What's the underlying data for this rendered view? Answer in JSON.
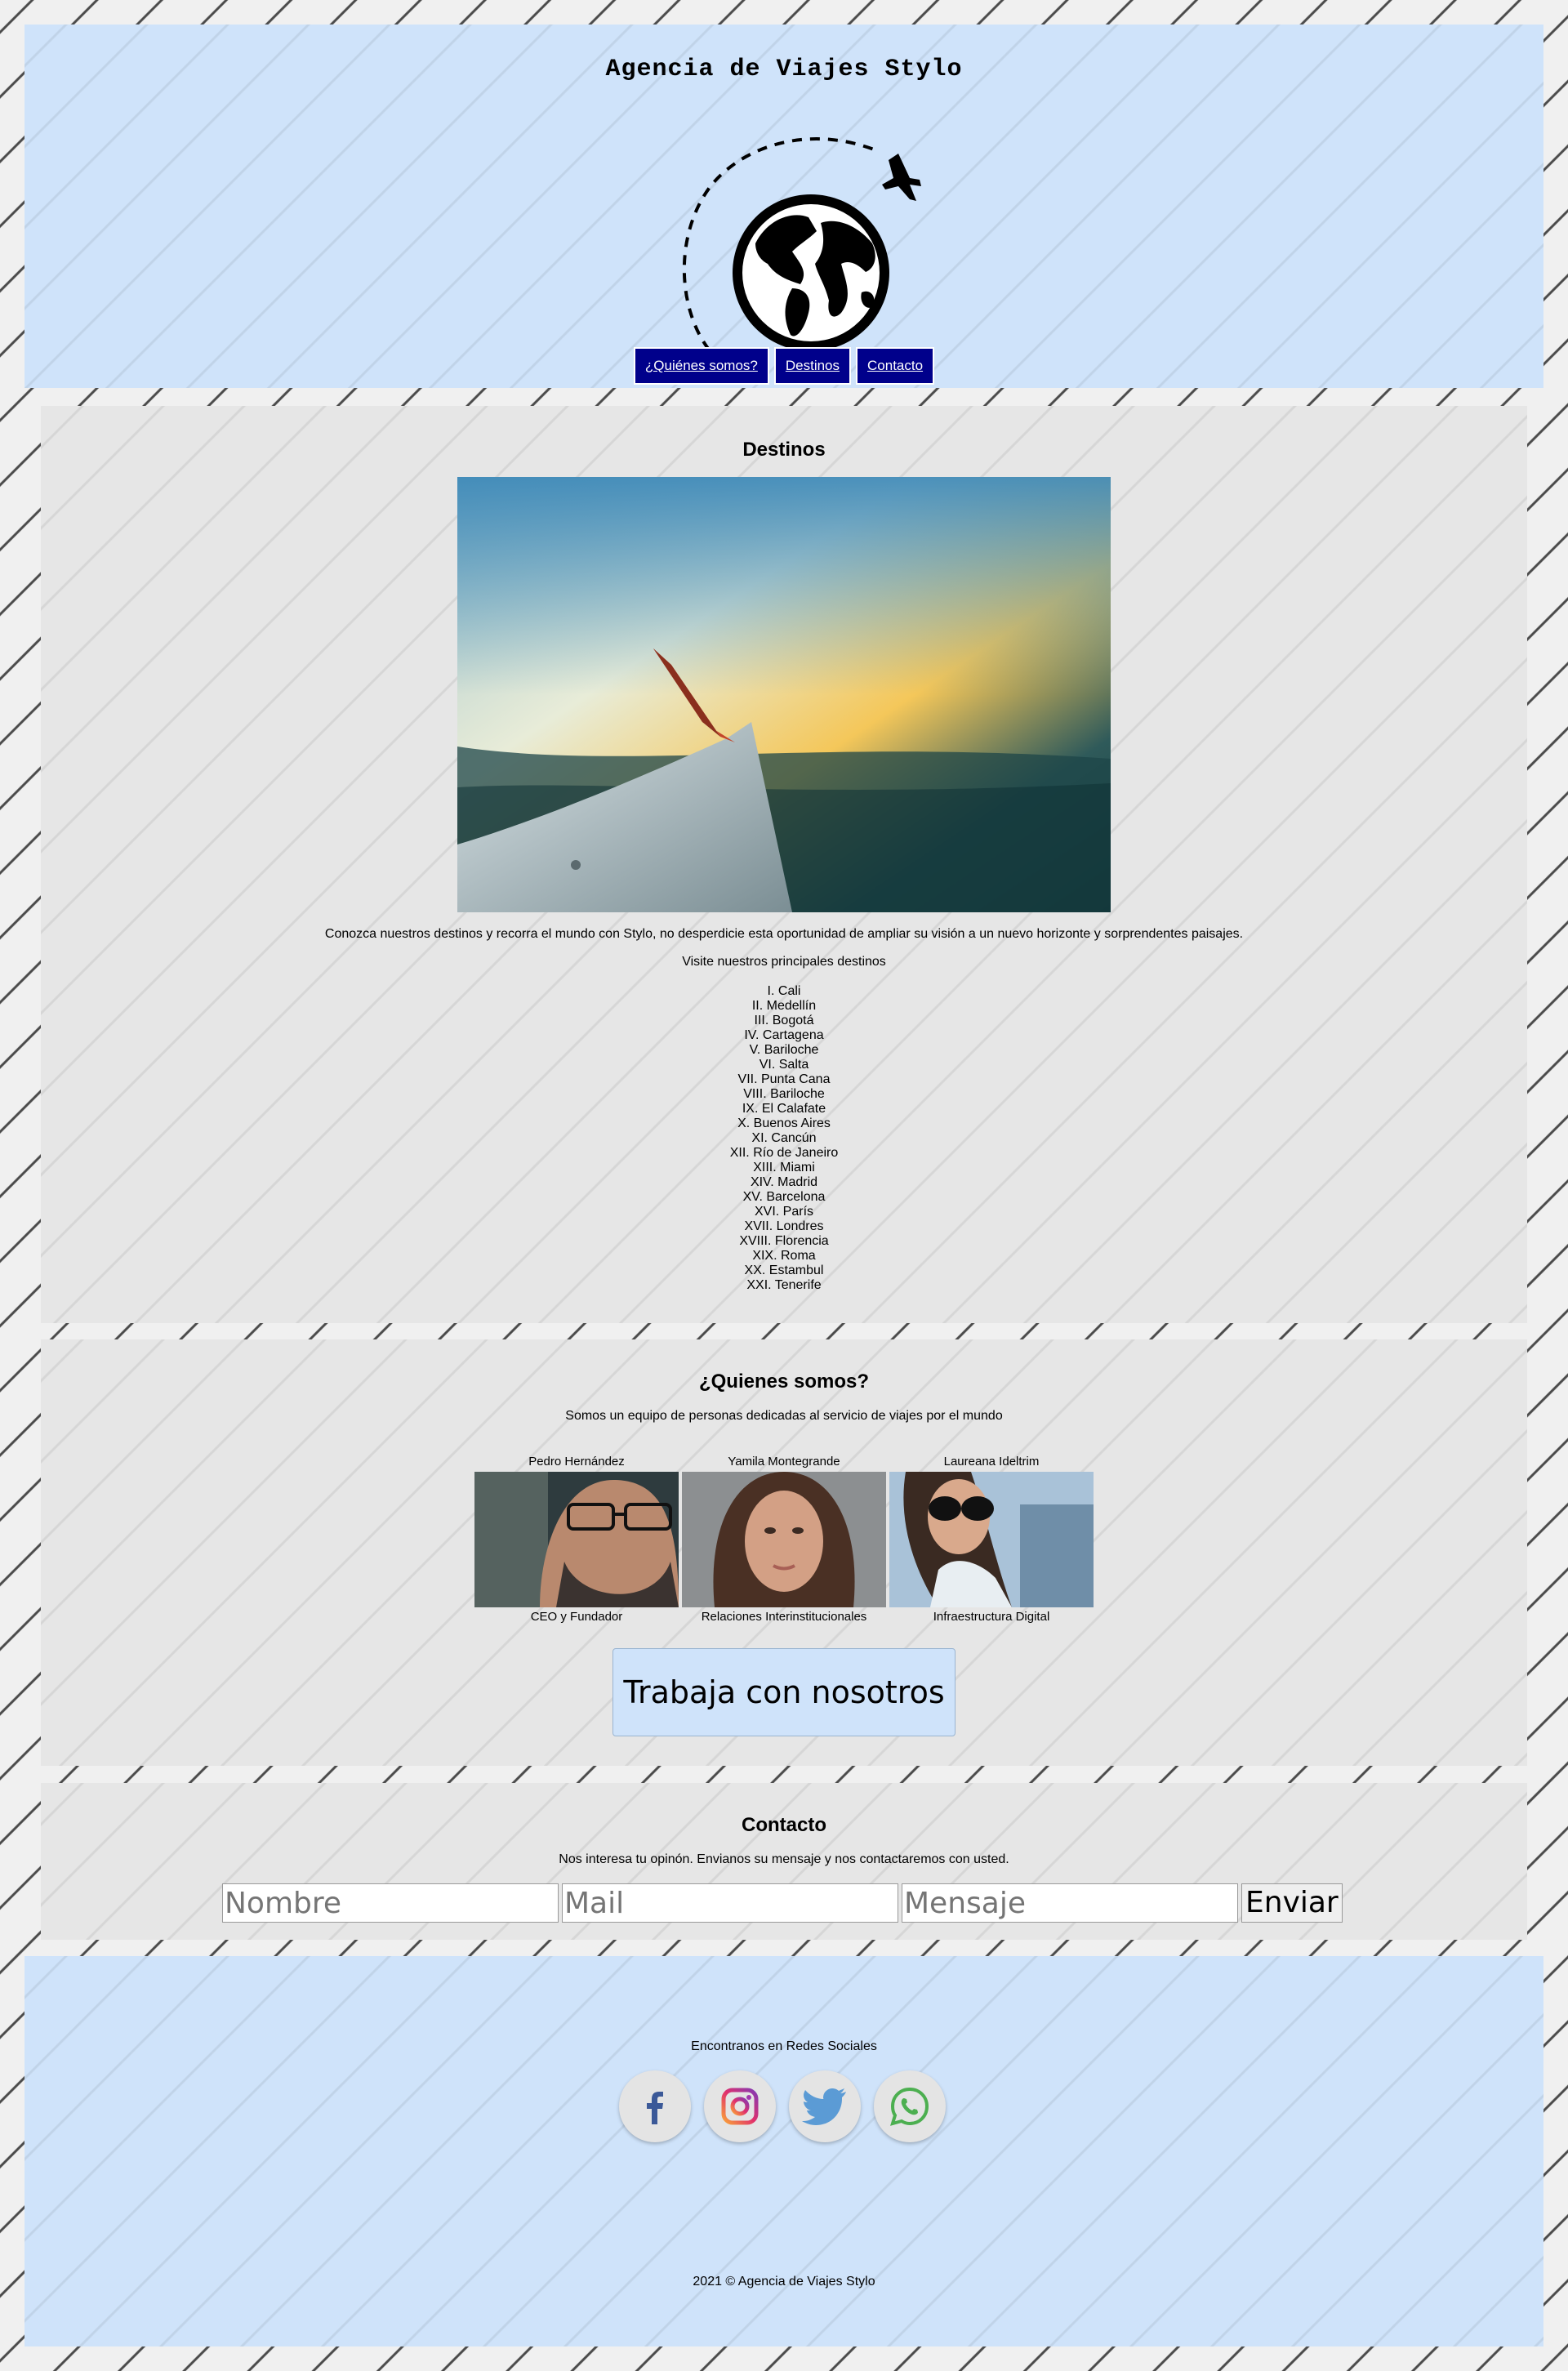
{
  "header": {
    "title": "Agencia de Viajes Stylo",
    "nav": [
      {
        "label": "¿Quiénes somos?"
      },
      {
        "label": "Destinos"
      },
      {
        "label": "Contacto"
      }
    ]
  },
  "destinos": {
    "title": "Destinos",
    "hero_image": "airplane-wing-over-clouds",
    "intro": "Conozca nuestros destinos y recorra el mundo con Stylo, no desperdicie esta oportunidad de ampliar su visión a un nuevo horizonte y sorprendentes paisajes.",
    "list_heading": "Visite nuestros principales destinos",
    "list": [
      "I. Cali",
      "II. Medellín",
      "III. Bogotá",
      "IV. Cartagena",
      "V. Bariloche",
      "VI. Salta",
      "VII. Punta Cana",
      "VIII. Bariloche",
      "IX. El Calafate",
      "X. Buenos Aires",
      "XI. Cancún",
      "XII. Río de Janeiro",
      "XIII. Miami",
      "XIV. Madrid",
      "XV. Barcelona",
      "XVI. París",
      "XVII. Londres",
      "XVIII. Florencia",
      "XIX. Roma",
      "XX. Estambul",
      "XXI. Tenerife"
    ]
  },
  "quienes": {
    "title": "¿Quienes somos?",
    "intro": "Somos un equipo de personas dedicadas al servicio de viajes por el mundo",
    "team": [
      {
        "name": "Pedro Hernández",
        "role": "CEO y Fundador"
      },
      {
        "name": "Yamila Montegrande",
        "role": "Relaciones Interinstitucionales"
      },
      {
        "name": "Laureana Ideltrim",
        "role": "Infraestructura Digital"
      }
    ],
    "cta": "Trabaja con nosotros"
  },
  "contacto": {
    "title": "Contacto",
    "intro": "Nos interesa tu opinón. Envianos su mensaje y nos contactaremos con usted.",
    "placeholders": {
      "name": "Nombre",
      "mail": "Mail",
      "message": "Mensaje"
    },
    "submit": "Enviar"
  },
  "footer": {
    "social_label": "Encontranos en Redes Sociales",
    "social": [
      "facebook-icon",
      "instagram-icon",
      "twitter-icon",
      "whatsapp-icon"
    ],
    "copyright": "2021 © Agencia de Viajes Stylo"
  },
  "colors": {
    "header_bg": "#cfe3fa",
    "section_bg": "#e6e6e6",
    "nav_bg": "#00008b"
  }
}
